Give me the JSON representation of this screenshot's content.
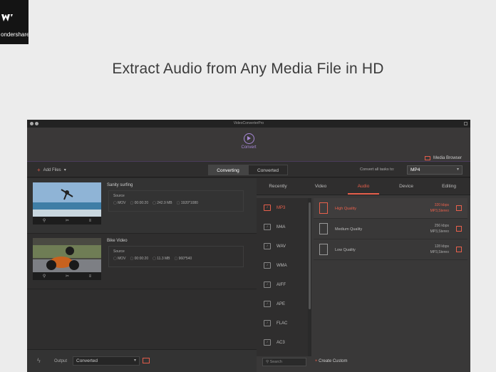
{
  "brand": {
    "name": "ondershare"
  },
  "headline": "Extract Audio from Any Media File in HD",
  "window": {
    "title": "VideoConverterPro",
    "convert_label": "Convert",
    "media_browser": "Media Browser"
  },
  "toolbar": {
    "add_files": "Add Files",
    "tabs": [
      "Converting",
      "Converted"
    ],
    "convert_all_label": "Convert all tasks to:",
    "format_selected": "MP4"
  },
  "files": [
    {
      "name": "Sanity surfing",
      "source_label": "Source",
      "meta": [
        "MOV",
        "00:00:20",
        "242.9 MB",
        "1920*1080"
      ]
    },
    {
      "name": "Bike Video",
      "source_label": "Source",
      "meta": [
        "MOV",
        "00:00:20",
        "11.3 MB",
        "960*540"
      ]
    }
  ],
  "categories": [
    "Recently",
    "Video",
    "Audio",
    "Device",
    "Editing"
  ],
  "active_category": "Audio",
  "formats": [
    "MP3",
    "M4A",
    "WAV",
    "WMA",
    "AIFF",
    "APE",
    "FLAC",
    "AC3"
  ],
  "qualities": [
    {
      "name": "High Quality",
      "bitrate": "320 kbps",
      "codec": "MP3,Stereo"
    },
    {
      "name": "Medium Quality",
      "bitrate": "256 kbps",
      "codec": "MP3,Stereo"
    },
    {
      "name": "Low Quality",
      "bitrate": "128 kbps",
      "codec": "MP3,Stereo"
    }
  ],
  "search_placeholder": "Search",
  "create_custom": "Create Custom",
  "output": {
    "label": "Output",
    "value": "Converted"
  },
  "colors": {
    "accent": "#e8604c",
    "convert": "#a889d8"
  }
}
